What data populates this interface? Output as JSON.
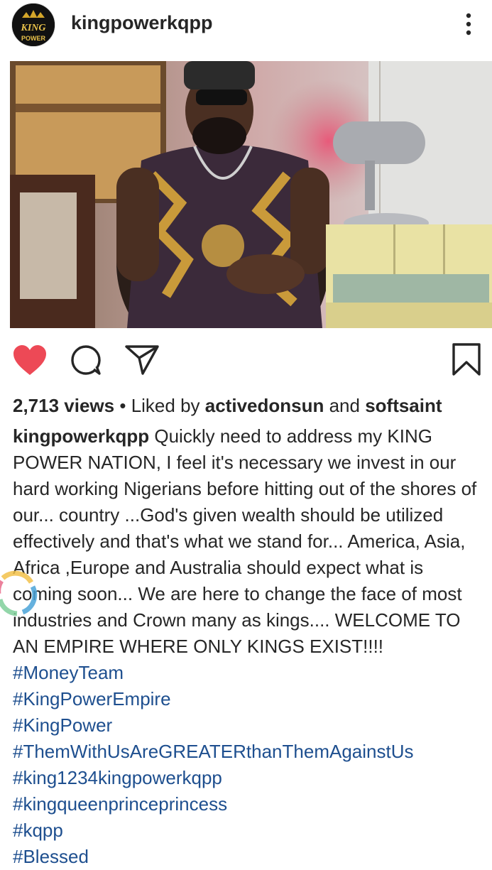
{
  "post": {
    "username": "kingpowerkqpp",
    "avatar_text": "KING POWER",
    "views": "2,713 views",
    "separator": " • ",
    "liked_by_prefix": "Liked by ",
    "liker1": "activedonsun",
    "and_word": " and ",
    "liker2": "softsaint",
    "caption_text": "Quickly need to address my KING POWER NATION, I feel it's necessary we invest in our hard working Nigerians before hitting out of the shores of our... country ...God's given wealth should be utilized effectively and that's what we stand for... America, Asia, Africa ,Europe and Australia should expect what is coming soon... We are here to change the face of most industries and Crown many as kings.... WELCOME TO AN EMPIRE WHERE ONLY KINGS EXIST!!!! ",
    "hashtags": [
      "#MoneyTeam",
      "#KingPowerEmpire",
      "#KingPower",
      "#ThemWithUsAreGREATERthanThemAgainstUs",
      "#king1234kingpowerkqpp",
      "#kingqueenprinceprincess",
      "#kqpp",
      "#Blessed"
    ]
  },
  "icons": {
    "like": "heart-icon",
    "comment": "comment-icon",
    "share": "send-icon",
    "save": "bookmark-icon",
    "more": "more-vertical-icon"
  },
  "colors": {
    "liked": "#ed4956",
    "hashtag": "#1e4f8f",
    "text": "#262626"
  }
}
